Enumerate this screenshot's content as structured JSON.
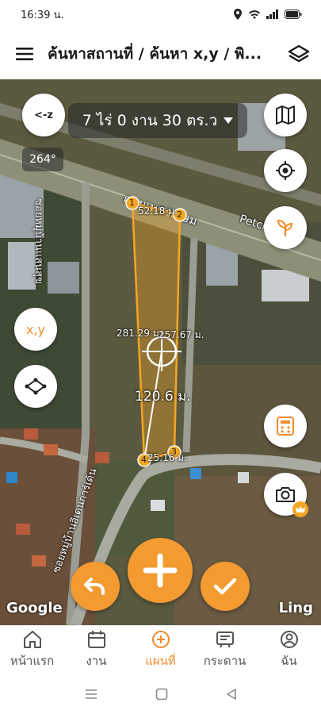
{
  "status": {
    "time": "16:39 น.",
    "icons": [
      "location-icon",
      "wifi-icon",
      "signal-icon",
      "battery-icon"
    ]
  },
  "header": {
    "title": "ค้นหาสถานที่ / ค้นหา x,y / พิ...",
    "menu_icon": "hamburger-menu-icon",
    "layers_icon": "layers-icon"
  },
  "map": {
    "area_label": "7 ไร่ 0 งาน 30 ตร.ว",
    "bearing": "264°",
    "compass_label": "<-z",
    "xy_label": "x,y",
    "road_label_th": "ถนนเพชรเกษม",
    "road_label_en": "Petchkase",
    "soi_label_1": "ซอยหมู่บ้านแสนสุข",
    "soi_label_2": "ซอยหมู่บ้านอิเดนการ์เด้น",
    "side_1": "52.18 ม.",
    "side_2": "281.29 ม.",
    "side_3": "257.67 ม.",
    "side_4": "25.16 ม.",
    "measure": "120.6 ม.",
    "vertices": [
      "1",
      "2",
      "3",
      "4"
    ],
    "google_label": "Google",
    "ling_label": "Ling"
  },
  "nav": {
    "items": [
      {
        "label": "หน้าแรก",
        "icon": "home-icon"
      },
      {
        "label": "งาน",
        "icon": "calendar-icon"
      },
      {
        "label": "แผนที่",
        "icon": "add-circle-icon"
      },
      {
        "label": "กระดาน",
        "icon": "board-icon"
      },
      {
        "label": "ฉัน",
        "icon": "profile-icon"
      }
    ],
    "active": "แผนที่"
  },
  "colors": {
    "accent": "#f28c28",
    "fab_orange": "#f39a30",
    "polygon": "#f5a623"
  }
}
